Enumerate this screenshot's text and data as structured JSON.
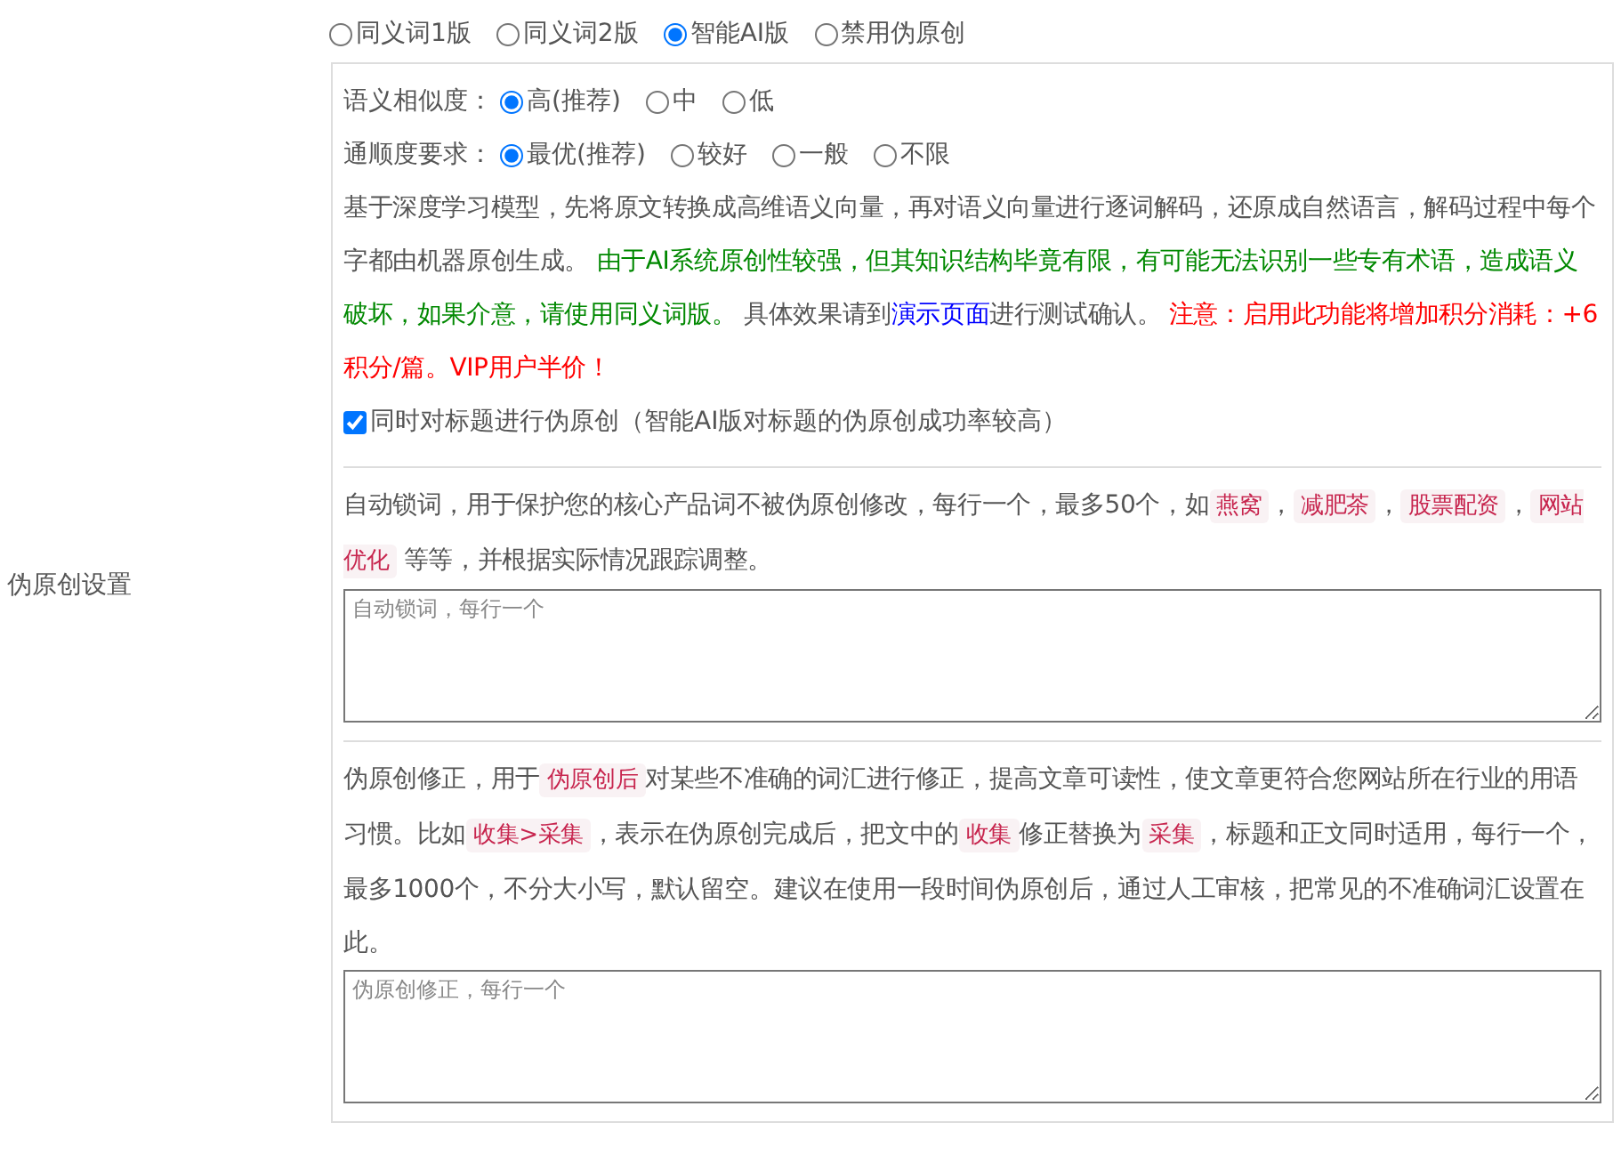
{
  "side_label": "伪原创设置",
  "modes": [
    {
      "label": "同义词1版",
      "selected": false
    },
    {
      "label": "同义词2版",
      "selected": false
    },
    {
      "label": "智能AI版",
      "selected": true
    },
    {
      "label": "禁用伪原创",
      "selected": false
    }
  ],
  "options": [
    {
      "label": "语义相似度：",
      "choices": [
        {
          "label": "高(推荐)",
          "selected": true
        },
        {
          "label": "中",
          "selected": false
        },
        {
          "label": "低",
          "selected": false
        }
      ]
    },
    {
      "label": "通顺度要求：",
      "choices": [
        {
          "label": "最优(推荐)",
          "selected": true
        },
        {
          "label": "较好",
          "selected": false
        },
        {
          "label": "一般",
          "selected": false
        },
        {
          "label": "不限",
          "selected": false
        }
      ]
    }
  ],
  "description": [
    {
      "kind": "text",
      "text": "基于深度学习模型，先将原文转换成高维语义向量，再对语义向量进行逐词解码，还原成自然语言，解码过程中每个字都由机器原创生成。 "
    },
    {
      "kind": "note",
      "text": "由于AI系统原创性较强，但其知识结构毕竟有限，有可能无法识别一些专有术语，造成语义破坏，如果介意，请使用同义词版。"
    },
    {
      "kind": "text",
      "text": " 具体效果请到"
    },
    {
      "kind": "link",
      "text": "演示页面"
    },
    {
      "kind": "text",
      "text": "进行测试确认。 "
    },
    {
      "kind": "warn",
      "text": "注意：启用此功能将增加积分消耗：+6积分/篇。VIP用户半价！"
    }
  ],
  "title_checkbox": {
    "label": "同时对标题进行伪原创（智能AI版对标题的伪原创成功率较高）",
    "checked": true
  },
  "lock_words": {
    "description": [
      {
        "kind": "text",
        "text": "自动锁词，用于保护您的核心产品词不被伪原创修改，每行一个，最多50个，如"
      },
      {
        "kind": "code",
        "text": "燕窝"
      },
      {
        "kind": "text",
        "text": "，"
      },
      {
        "kind": "code",
        "text": "减肥茶"
      },
      {
        "kind": "text",
        "text": "，"
      },
      {
        "kind": "code",
        "text": "股票配资"
      },
      {
        "kind": "text",
        "text": "，"
      },
      {
        "kind": "code",
        "text": "网站优化"
      },
      {
        "kind": "text",
        "text": " 等等，并根据实际情况跟踪调整。"
      }
    ],
    "placeholder": "自动锁词，每行一个"
  },
  "corrections": {
    "description": [
      {
        "kind": "text",
        "text": "伪原创修正，用于"
      },
      {
        "kind": "code",
        "text": "伪原创后"
      },
      {
        "kind": "text",
        "text": "对某些不准确的词汇进行修正，提高文章可读性，使文章更符合您网站所在行业的用语习惯。比如"
      },
      {
        "kind": "code",
        "text": "收集>采集"
      },
      {
        "kind": "text",
        "text": "，表示在伪原创完成后，把文中的"
      },
      {
        "kind": "code",
        "text": "收集"
      },
      {
        "kind": "text",
        "text": "修正替换为"
      },
      {
        "kind": "code",
        "text": "采集"
      },
      {
        "kind": "text",
        "text": "，标题和正文同时适用，每行一个，最多1000个，不分大小写，默认留空。建议在使用一段时间伪原创后，通过人工审核，把常见的不准确词汇设置在此。"
      }
    ],
    "placeholder": "伪原创修正，每行一个"
  }
}
